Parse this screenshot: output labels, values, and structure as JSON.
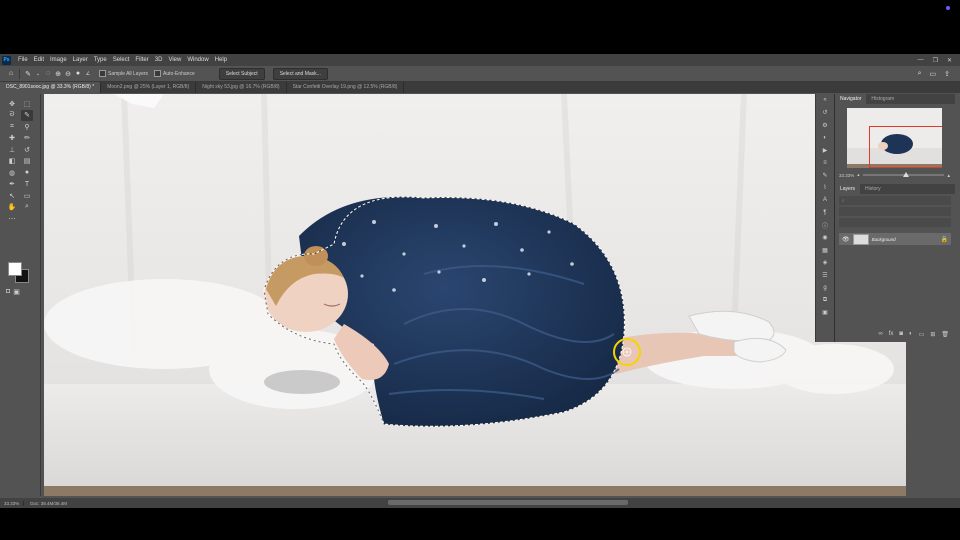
{
  "app": {
    "logo": "Ps",
    "menu": [
      "File",
      "Edit",
      "Image",
      "Layer",
      "Type",
      "Select",
      "Filter",
      "3D",
      "View",
      "Window",
      "Help"
    ],
    "window_controls": [
      "—",
      "❐",
      "✕"
    ]
  },
  "options_bar": {
    "sample_all_layers": "Sample All Layers",
    "auto_enhance": "Auto-Enhance",
    "select_subject": "Select Subject",
    "select_and_mask": "Select and Mask..."
  },
  "tabs": [
    {
      "label": "DSC_8901sooc.jpg @ 33.3% (RGB/8) *"
    },
    {
      "label": "Moon2.png @ 25% (Layer 1, RGB/8)"
    },
    {
      "label": "Night sky 53.jpg @ 16.7% (RGB/8)"
    },
    {
      "label": "Star Confetti Overlay 19.png @ 12.5% (RGB/8)"
    }
  ],
  "panels": {
    "navigator_tab": "Navigator",
    "histogram_tab": "Histogram",
    "zoom_value": "33.33%",
    "layers_tab": "Layers",
    "history_tab": "History",
    "layer_name": "Background"
  },
  "status": {
    "zoom": "33.33%",
    "doc": "Doc: 38.4M/38.4M"
  },
  "colors": {
    "accent_marker": "#f5d400",
    "nav_view_box": "#e23a2a",
    "dress": "#1f3556"
  }
}
